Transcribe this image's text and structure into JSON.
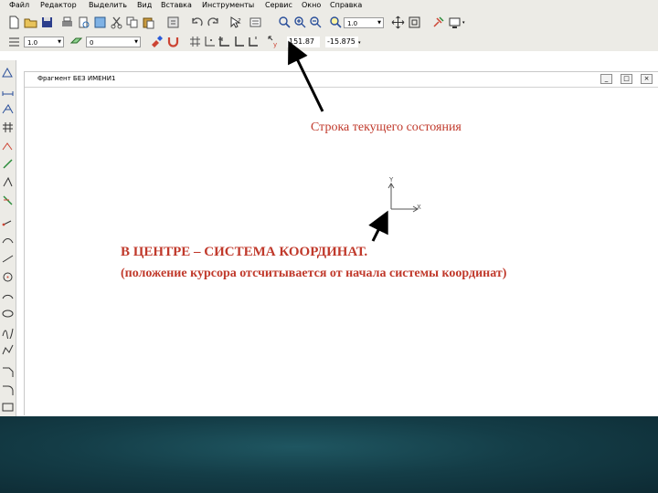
{
  "menu": {
    "items": [
      "Файл",
      "Редактор",
      "Выделить",
      "Вид",
      "Вставка",
      "Инструменты",
      "Сервис",
      "Окно",
      "Справка"
    ]
  },
  "toolbar": {
    "zoom_value": "1.0",
    "style_value": "1.0",
    "layer_value": "0",
    "coord_x": "151.87",
    "coord_y": "-15.875"
  },
  "document": {
    "title": "Фрагмент БЕЗ ИМЕНИ1",
    "minimize": "_",
    "maximize": "□",
    "close": "×"
  },
  "axes": {
    "y_label": "Y",
    "x_label": "X"
  },
  "annotations": {
    "status_label": "Строка текущего состояния",
    "main_text": "В ЦЕНТРЕ – СИСТЕМА КООРДИНАТ.",
    "sub_text": "(положение курсора отсчитывается от начала системы координат)"
  },
  "colors": {
    "annotation": "#c0392b",
    "toolbar_bg": "#ecebe6",
    "bottom_band": "#143d47"
  }
}
